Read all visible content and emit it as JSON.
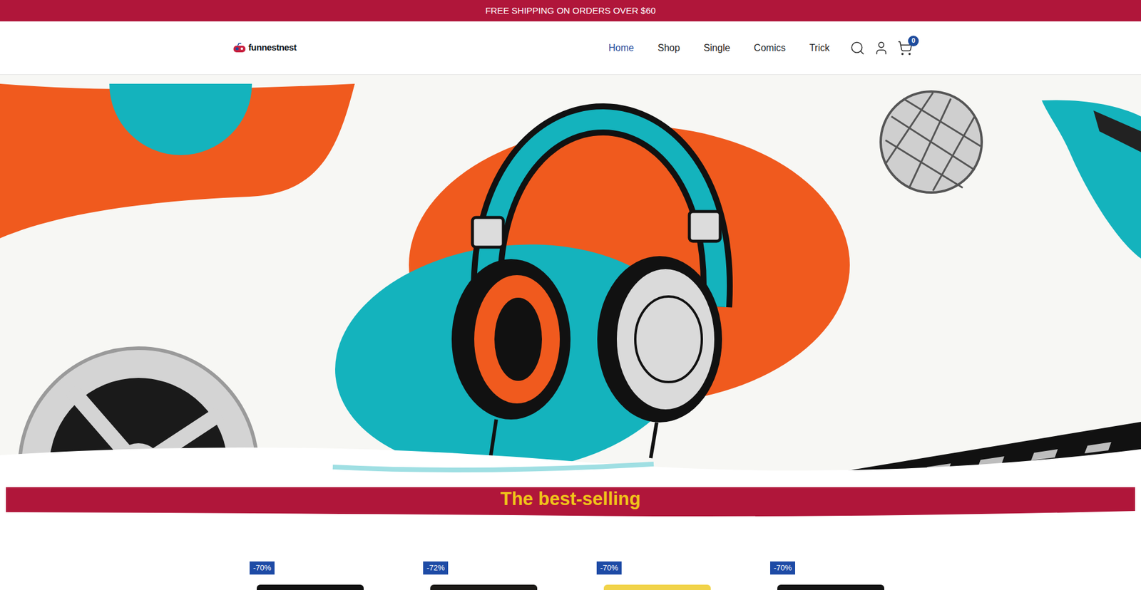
{
  "announcement": "FREE SHIPPING ON ORDERS OVER $60",
  "logo": {
    "text": "funnestnest"
  },
  "nav": [
    {
      "label": "Home",
      "selected": true
    },
    {
      "label": "Shop",
      "selected": false
    },
    {
      "label": "Single",
      "selected": false
    },
    {
      "label": "Comics",
      "selected": false
    },
    {
      "label": "Trick",
      "selected": false
    }
  ],
  "cart": {
    "count": "0"
  },
  "section_title": "The best-selling",
  "products": [
    {
      "badge": "-70%",
      "color": "#111111"
    },
    {
      "badge": "-72%",
      "color": "#1c1a17"
    },
    {
      "badge": "-70%",
      "color": "#f1d34a"
    },
    {
      "badge": "-70%",
      "color": "#141414"
    }
  ]
}
